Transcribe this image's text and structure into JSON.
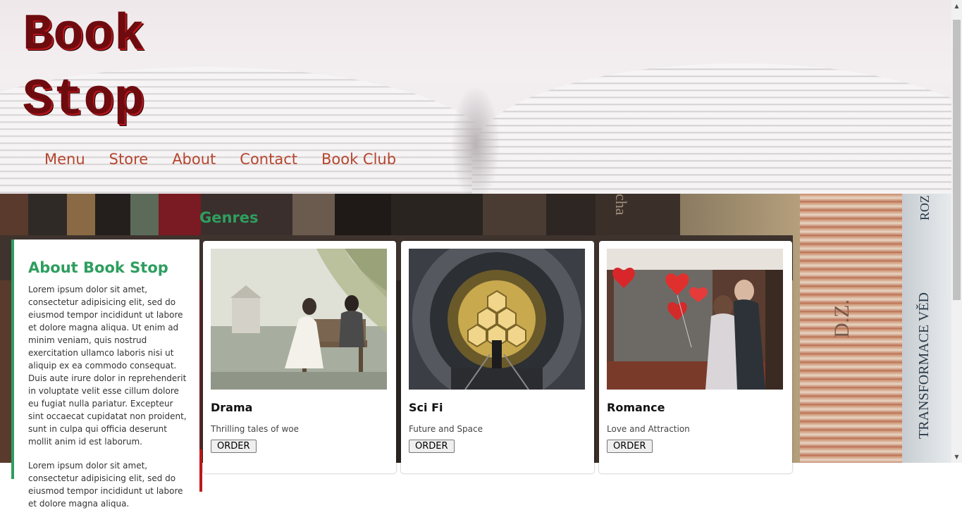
{
  "site": {
    "logo_line1": "Book",
    "logo_line2": "Stop"
  },
  "nav": {
    "items": [
      "Menu",
      "Store",
      "About",
      "Contact",
      "Book Club"
    ]
  },
  "genres": {
    "title": "Genres",
    "cards": [
      {
        "title": "Drama",
        "description": "Thrilling tales of woe",
        "button": "ORDER"
      },
      {
        "title": "Sci Fi",
        "description": "Future and Space",
        "button": "ORDER"
      },
      {
        "title": "Romance",
        "description": "Love and Attraction",
        "button": "ORDER"
      }
    ]
  },
  "about": {
    "title": "About Book Stop",
    "paragraph1": "Lorem ipsum dolor sit amet, consectetur adipisicing elit, sed do eiusmod tempor incididunt ut labore et dolore magna aliqua. Ut enim ad minim veniam, quis nostrud exercitation ullamco laboris nisi ut aliquip ex ea commodo consequat. Duis aute irure dolor in reprehenderit in voluptate velit esse cillum dolore eu fugiat nulla pariatur. Excepteur sint occaecat cupidatat non proident, sunt in culpa qui officia deserunt mollit anim id est laborum.",
    "paragraph2": "Lorem ipsum dolor sit amet, consectetur adipisicing elit, sed do eiusmod tempor incididunt ut labore et dolore magna aliqua."
  },
  "background_spine_text": [
    "ROZ",
    "TRANSFORMACE VĚD",
    "D.Z.",
    "cha"
  ],
  "colors": {
    "logo": "#6e0b0f",
    "nav_link": "#b5462e",
    "accent_green": "#2e9e5f",
    "band": "#3f332e"
  },
  "icons": {
    "scroll_up": "▲",
    "scroll_down": "▼"
  }
}
